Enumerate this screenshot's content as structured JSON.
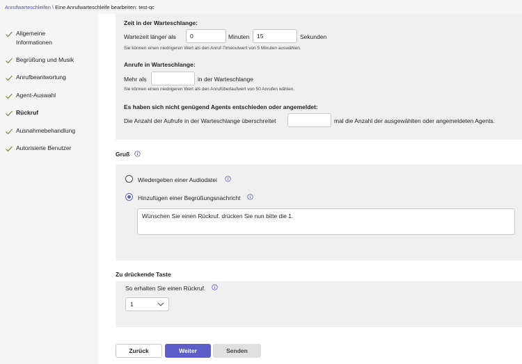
{
  "breadcrumb": {
    "link": "Anrufwarteschleifen",
    "separator": "\\",
    "current": "Eine Anrufwarteschleife bearbeiten: test-qc"
  },
  "nav": {
    "items": [
      {
        "label": "Allgemeine\nInformationen",
        "active": false
      },
      {
        "label": "Begrüßung und Musik",
        "active": false
      },
      {
        "label": "Anrufbeantwortung",
        "active": false
      },
      {
        "label": "Agent-Auswahl",
        "active": false
      },
      {
        "label": "Rückruf",
        "active": true
      },
      {
        "label": "Ausnahmebehandlung",
        "active": false
      },
      {
        "label": "Autorisierte Benutzer",
        "active": false
      }
    ]
  },
  "queue_time": {
    "heading": "Zeit in der Warteschlange:",
    "label": "Wartezeit länger als",
    "minutes_value": "0",
    "minutes_unit": "Minuten",
    "seconds_value": "15",
    "seconds_unit": "Sekunden",
    "hint": "Sie können einen niedrigeren Wert als den Anruf-Timeoutwert von 5 Minuten auswählen."
  },
  "queue_calls": {
    "heading": "Anrufe in Warteschlange:",
    "label_before": "Mehr als",
    "value": "",
    "label_after": "in der Warteschlange",
    "hint": "Sie können einen niedrigeren Wert als den Anrufüberlaufwert von 50 Anrufen wählen."
  },
  "agents": {
    "heading": "Es haben sich nicht genügend Agents entschieden oder angemeldet:",
    "label_before": "Die Anzahl der Aufrufe in der Warteschlange überschreitet",
    "value": "",
    "label_after": "mal die Anzahl der ausgewählten oder angemeldeten Agents."
  },
  "greeting": {
    "title": "Gruß",
    "option_audio": "Wiedergeben einer Audiodatei",
    "option_message": "Hinzufügen einer Begrüßungsnachricht",
    "selected": "message",
    "message_text": "Wünschen Sie einen Rückruf. drücken Sie nun bitte die 1."
  },
  "key": {
    "title": "Zu drückende Taste",
    "label": "So erhalten Sie einen Rückruf.",
    "selected": "1"
  },
  "buttons": {
    "back": "Zurück",
    "next": "Weiter",
    "send": "Senden"
  },
  "colors": {
    "accent": "#5b5fc7",
    "link": "#4f52b2",
    "check": "#6a8f3a"
  }
}
